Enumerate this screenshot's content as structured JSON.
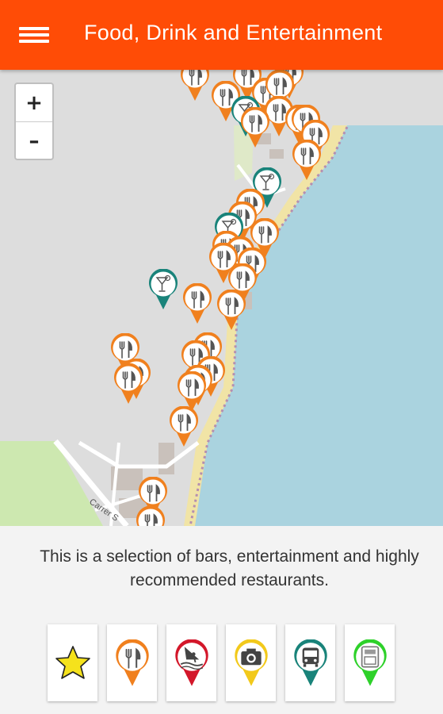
{
  "app": {
    "title": "Food, Drink and Entertainment",
    "menu_icon": "hamburger-menu-icon"
  },
  "map": {
    "zoom_in_label": "+",
    "zoom_out_label": "–",
    "street_label": "Carrer S",
    "colors": {
      "land": "#dddddd",
      "sea": "#aad3df",
      "beach": "#f1e4a6",
      "green": "#cde8b0",
      "restaurant_pin": "#f0801e",
      "bar_pin": "#19837a"
    }
  },
  "description": "This is a selection of bars, entertainment and highly recommended restaurants.",
  "categories": [
    {
      "name": "favorites",
      "icon": "star-icon",
      "color": "#f5e21c"
    },
    {
      "name": "restaurants",
      "icon": "fork-knife-icon",
      "color": "#f0801e"
    },
    {
      "name": "watersports",
      "icon": "windsurf-icon",
      "color": "#d3172a"
    },
    {
      "name": "sights",
      "icon": "camera-icon",
      "color": "#f2c91b"
    },
    {
      "name": "transport",
      "icon": "bus-icon",
      "color": "#19837a"
    },
    {
      "name": "atm",
      "icon": "atm-icon",
      "color": "#2ed12a"
    }
  ]
}
